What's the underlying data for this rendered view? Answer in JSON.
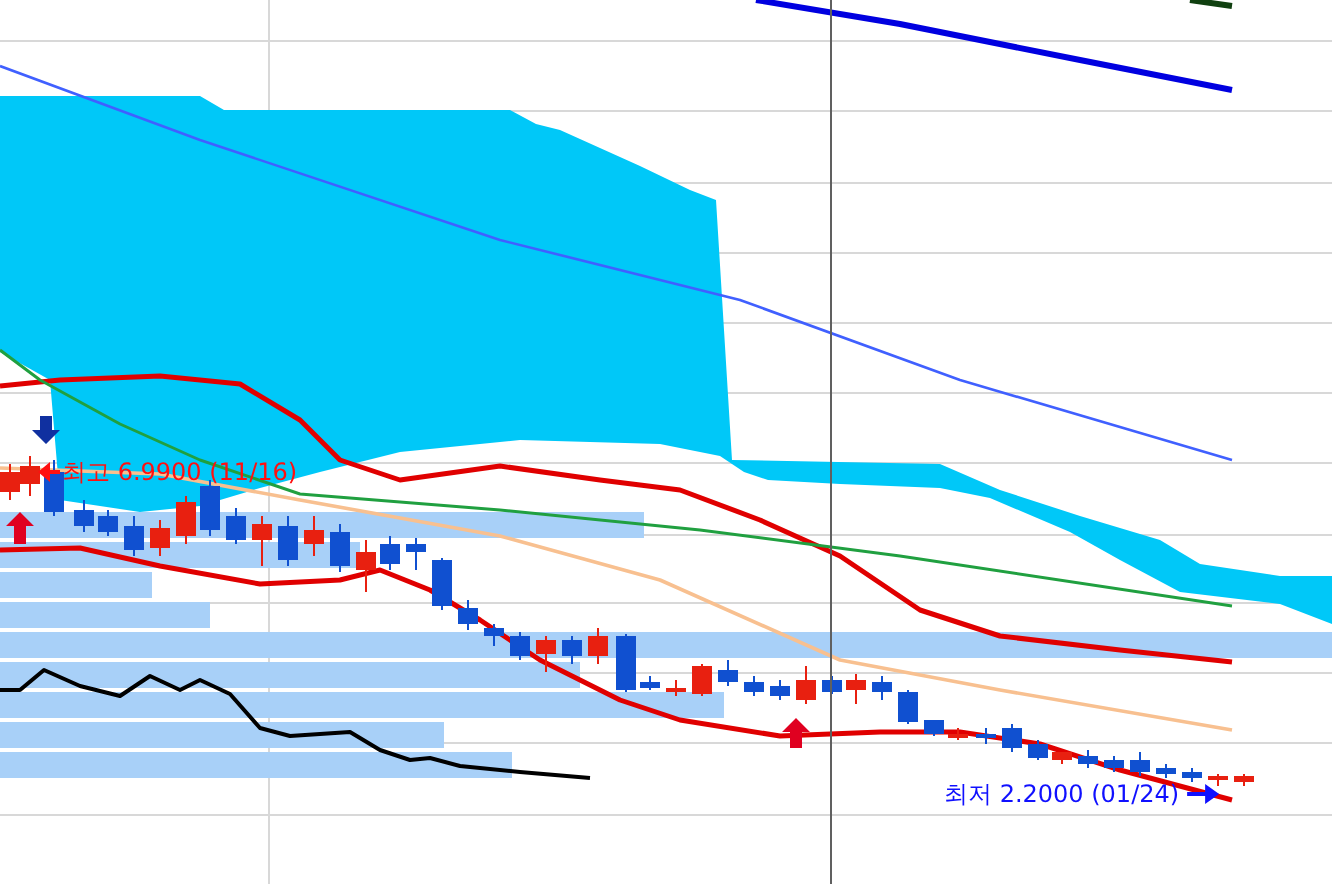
{
  "chart": {
    "price_labels": [
      {
        "kind": "high",
        "text": "최고 6.9900 (11/16)"
      },
      {
        "kind": "low",
        "text": "최저 2.2000 (01/24)"
      }
    ]
  }
}
